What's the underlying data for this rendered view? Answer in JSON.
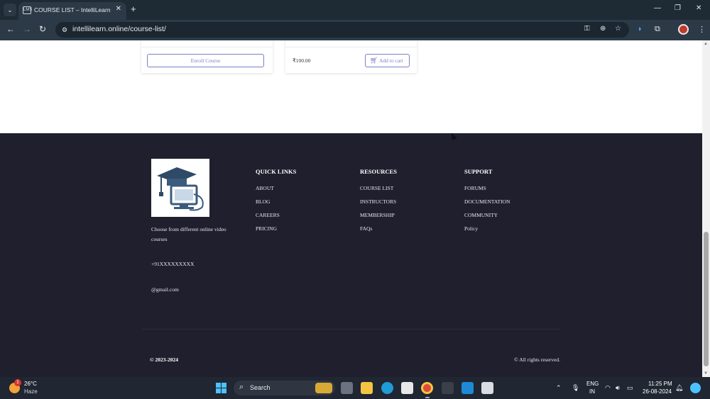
{
  "browser": {
    "tab_title": "COURSE LIST – IntelliLearn",
    "tab_favicon_text": "LMS",
    "url": "intellilearn.online/course-list/"
  },
  "cards": {
    "enroll_label": "Enroll Course",
    "price": "₹100.00",
    "add_to_cart_label": "Add to cart"
  },
  "footer": {
    "description": "Choose from different online video courses",
    "phone": "+91XXXXXXXXX",
    "email": "@gmail.com",
    "columns": [
      {
        "title": "QUICK LINKS",
        "links": [
          "ABOUT",
          "BLOG",
          "CAREERS",
          "PRICING"
        ]
      },
      {
        "title": "RESOURCES",
        "links": [
          "COURSE LIST",
          "INSTRUCTORS",
          "MEMBERSHIP",
          "FAQs"
        ]
      },
      {
        "title": "SUPPORT",
        "links": [
          "FORUMS",
          "DOCUMENTATION",
          "COMMUNITY",
          "Policy"
        ]
      }
    ],
    "copyright": "© 2023-2024",
    "rights": "© All rights reserved."
  },
  "taskbar": {
    "weather_badge": "1",
    "weather_temp": "26°C",
    "weather_condition": "Haze",
    "search_label": "Search",
    "language_top": "ENG",
    "language_bottom": "IN",
    "time": "11:25 PM",
    "date": "26-08-2024"
  },
  "colors": {
    "footer_bg": "#1f1f2e",
    "accent": "#7b7fc4",
    "browser_chrome": "#2b3a46"
  }
}
